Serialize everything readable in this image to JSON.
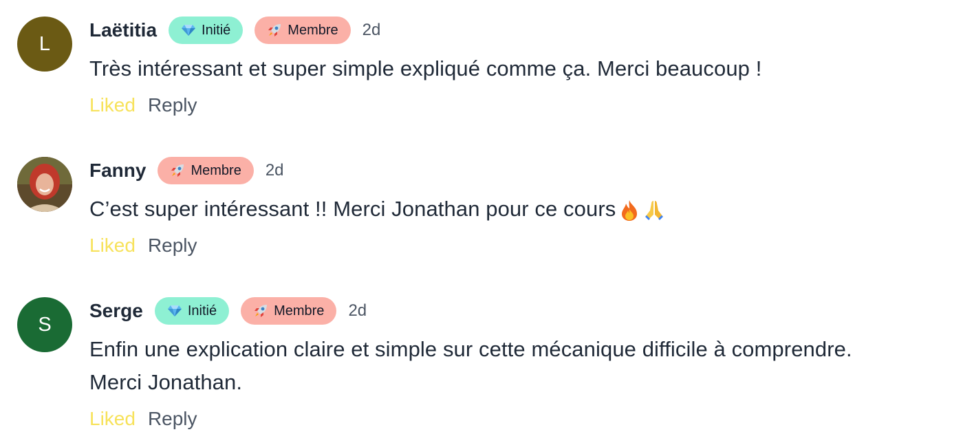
{
  "comments": [
    {
      "author": "Laëtitia",
      "avatar_initial": "L",
      "avatar_color": "#6b5a14",
      "badges": [
        {
          "label": "Initié",
          "icon": "gem-icon",
          "color": "#8ef0d3"
        },
        {
          "label": "Membre",
          "icon": "rocket-icon",
          "color": "#fbb0a7"
        }
      ],
      "time": "2d",
      "text_lines": [
        "Très intéressant et super simple expliqué comme ça. Merci beaucoup !"
      ],
      "liked_label": "Liked",
      "reply_label": "Reply"
    },
    {
      "author": "Fanny",
      "avatar_initial": "",
      "avatar_color": "#7a4a2e",
      "badges": [
        {
          "label": "Membre",
          "icon": "rocket-icon",
          "color": "#fbb0a7"
        }
      ],
      "time": "2d",
      "text_lines": [
        "C’est super intéressant !! Merci Jonathan pour ce cours"
      ],
      "emojis": [
        "fire-icon",
        "praying-hands-icon"
      ],
      "liked_label": "Liked",
      "reply_label": "Reply"
    },
    {
      "author": "Serge",
      "avatar_initial": "S",
      "avatar_color": "#1a6b34",
      "badges": [
        {
          "label": "Initié",
          "icon": "gem-icon",
          "color": "#8ef0d3"
        },
        {
          "label": "Membre",
          "icon": "rocket-icon",
          "color": "#fbb0a7"
        }
      ],
      "time": "2d",
      "text_lines": [
        "Enfin une explication claire et simple sur cette mécanique difficile à comprendre.",
        "Merci Jonathan."
      ],
      "liked_label": "Liked",
      "reply_label": "Reply"
    }
  ],
  "colors": {
    "liked": "#f7e25a",
    "reply": "#4b5563",
    "text": "#1f2937"
  }
}
